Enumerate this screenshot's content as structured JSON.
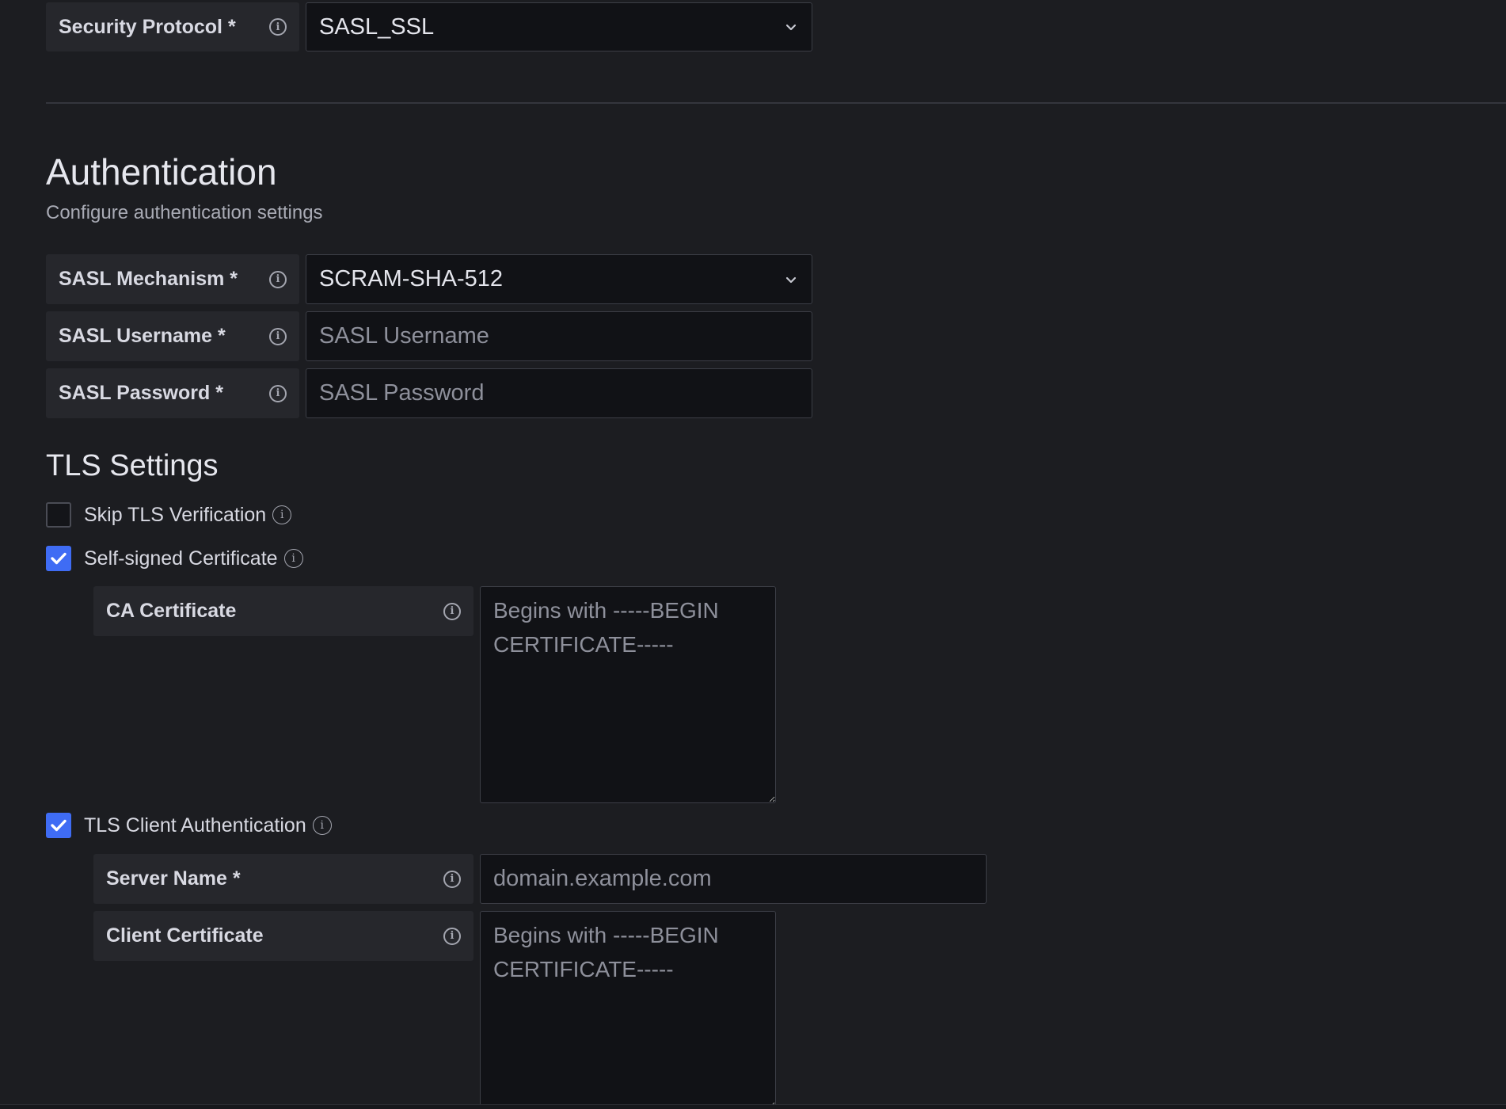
{
  "connection": {
    "security_protocol": {
      "label": "Security Protocol *",
      "value": "SASL_SSL"
    }
  },
  "authentication": {
    "title": "Authentication",
    "subtitle": "Configure authentication settings",
    "sasl_mechanism": {
      "label": "SASL Mechanism *",
      "value": "SCRAM-SHA-512"
    },
    "sasl_username": {
      "label": "SASL Username *",
      "placeholder": "SASL Username"
    },
    "sasl_password": {
      "label": "SASL Password *",
      "placeholder": "SASL Password"
    }
  },
  "tls": {
    "title": "TLS Settings",
    "skip_verification": {
      "label": "Skip TLS Verification",
      "checked": false
    },
    "self_signed": {
      "label": "Self-signed Certificate",
      "checked": true
    },
    "ca_certificate": {
      "label": "CA Certificate",
      "placeholder": "Begins with -----BEGIN CERTIFICATE-----"
    },
    "client_auth": {
      "label": "TLS Client Authentication",
      "checked": true
    },
    "server_name": {
      "label": "Server Name *",
      "placeholder": "domain.example.com"
    },
    "client_certificate": {
      "label": "Client Certificate",
      "placeholder": "Begins with -----BEGIN CERTIFICATE-----"
    }
  },
  "colors": {
    "background": "#1c1d21",
    "label_bg": "#26272c",
    "input_bg": "#111216",
    "accent": "#3f6cf4"
  },
  "icons": {
    "info": "info-icon",
    "chevron": "chevron-down-icon",
    "check": "check-icon"
  }
}
